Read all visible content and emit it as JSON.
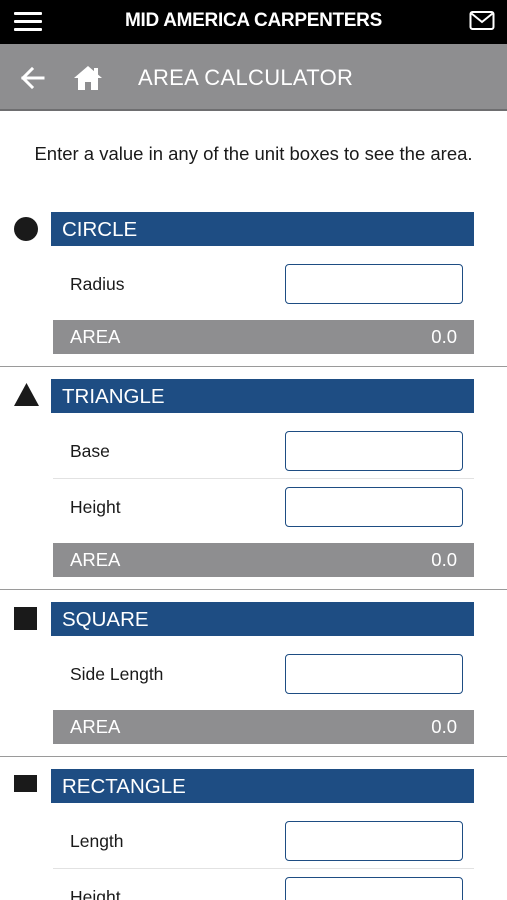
{
  "app": {
    "title": "MID AMERICA CARPENTERS",
    "menu_icon": "hamburger-menu-icon",
    "mail_icon": "mail-icon"
  },
  "nav": {
    "title": "AREA CALCULATOR",
    "back_icon": "back-arrow-icon",
    "home_icon": "home-icon"
  },
  "instructions": "Enter a value in any of the unit boxes to see the area.",
  "colors": {
    "top_bar": "#000000",
    "nav_bar": "#8e8e90",
    "section_header": "#1e4d83",
    "area_bar": "#8e8e90"
  },
  "sections": {
    "circle": {
      "title": "CIRCLE",
      "icon": "circle-icon",
      "fields": [
        {
          "label": "Radius",
          "value": ""
        }
      ],
      "area_label": "AREA",
      "area_value": "0.0"
    },
    "triangle": {
      "title": "TRIANGLE",
      "icon": "triangle-icon",
      "fields": [
        {
          "label": "Base",
          "value": ""
        },
        {
          "label": "Height",
          "value": ""
        }
      ],
      "area_label": "AREA",
      "area_value": "0.0"
    },
    "square": {
      "title": "SQUARE",
      "icon": "square-icon",
      "fields": [
        {
          "label": "Side Length",
          "value": ""
        }
      ],
      "area_label": "AREA",
      "area_value": "0.0"
    },
    "rectangle": {
      "title": "RECTANGLE",
      "icon": "rectangle-icon",
      "fields": [
        {
          "label": "Length",
          "value": ""
        },
        {
          "label": "Height",
          "value": ""
        }
      ]
    }
  }
}
